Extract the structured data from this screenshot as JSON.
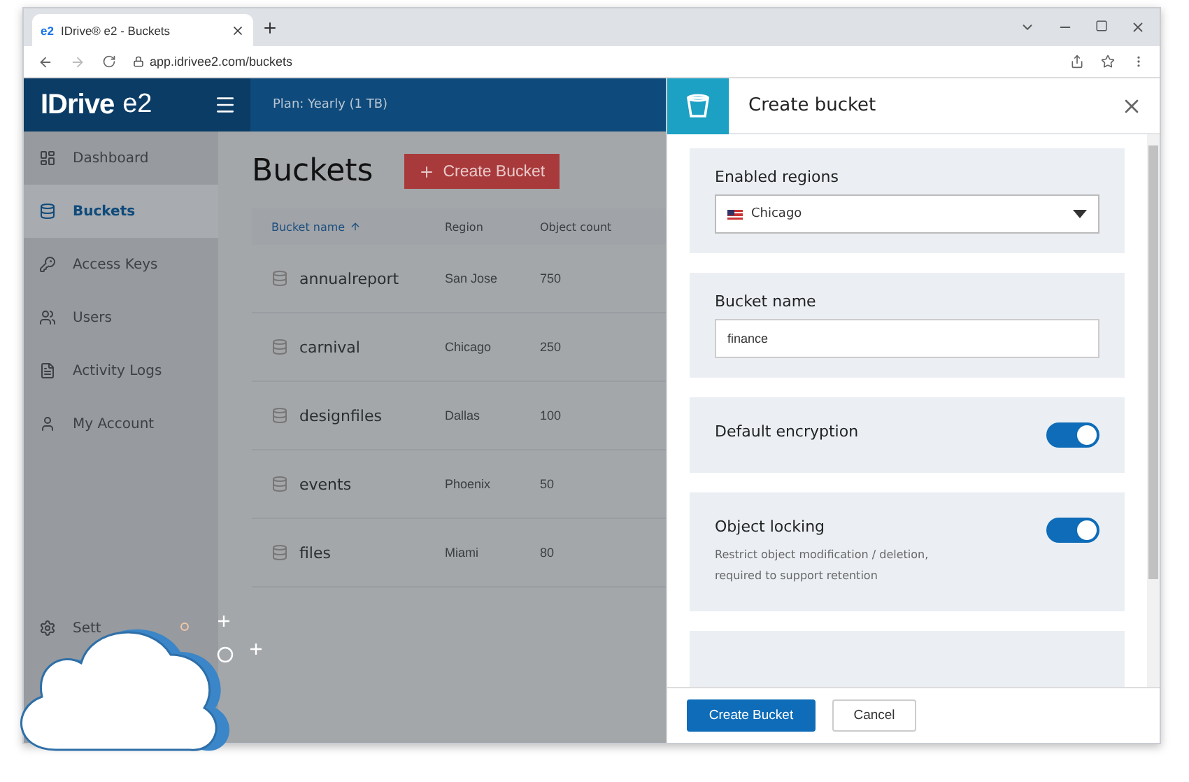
{
  "browser": {
    "tab_icon": "e2",
    "tab_title": "IDrive® e2 - Buckets",
    "url": "app.idrivee2.com/buckets"
  },
  "header": {
    "logo": "IDrive",
    "logo_suffix": "e2",
    "plan": "Plan: Yearly (1 TB)"
  },
  "sidebar": {
    "items": [
      {
        "label": "Dashboard",
        "selected": false
      },
      {
        "label": "Buckets",
        "selected": true
      },
      {
        "label": "Access Keys",
        "selected": false
      },
      {
        "label": "Users",
        "selected": false
      },
      {
        "label": "Activity Logs",
        "selected": false
      },
      {
        "label": "My Account",
        "selected": false
      }
    ],
    "settings": "Sett"
  },
  "page": {
    "title": "Buckets",
    "create_button": "Create Bucket"
  },
  "table": {
    "columns": [
      "Bucket name",
      "Region",
      "Object count"
    ],
    "rows": [
      {
        "name": "annualreport",
        "region": "San Jose",
        "count": "750"
      },
      {
        "name": "carnival",
        "region": "Chicago",
        "count": "250"
      },
      {
        "name": "designfiles",
        "region": "Dallas",
        "count": "100"
      },
      {
        "name": "events",
        "region": "Phoenix",
        "count": "50"
      },
      {
        "name": "files",
        "region": "Miami",
        "count": "80"
      }
    ]
  },
  "panel": {
    "title": "Create bucket",
    "sections": [
      {
        "kind": "select",
        "label": "Enabled regions",
        "value": "Chicago"
      },
      {
        "kind": "text",
        "label": "Bucket name",
        "value": "finance"
      },
      {
        "kind": "toggle",
        "label": "Default encryption",
        "on": true
      },
      {
        "kind": "toggle",
        "label": "Object locking",
        "description": "Restrict object modification / deletion, required to support retention",
        "on": true
      }
    ],
    "buttons": [
      {
        "label": "Create Bucket",
        "primary": true
      },
      {
        "label": "Cancel",
        "primary": false
      }
    ]
  }
}
